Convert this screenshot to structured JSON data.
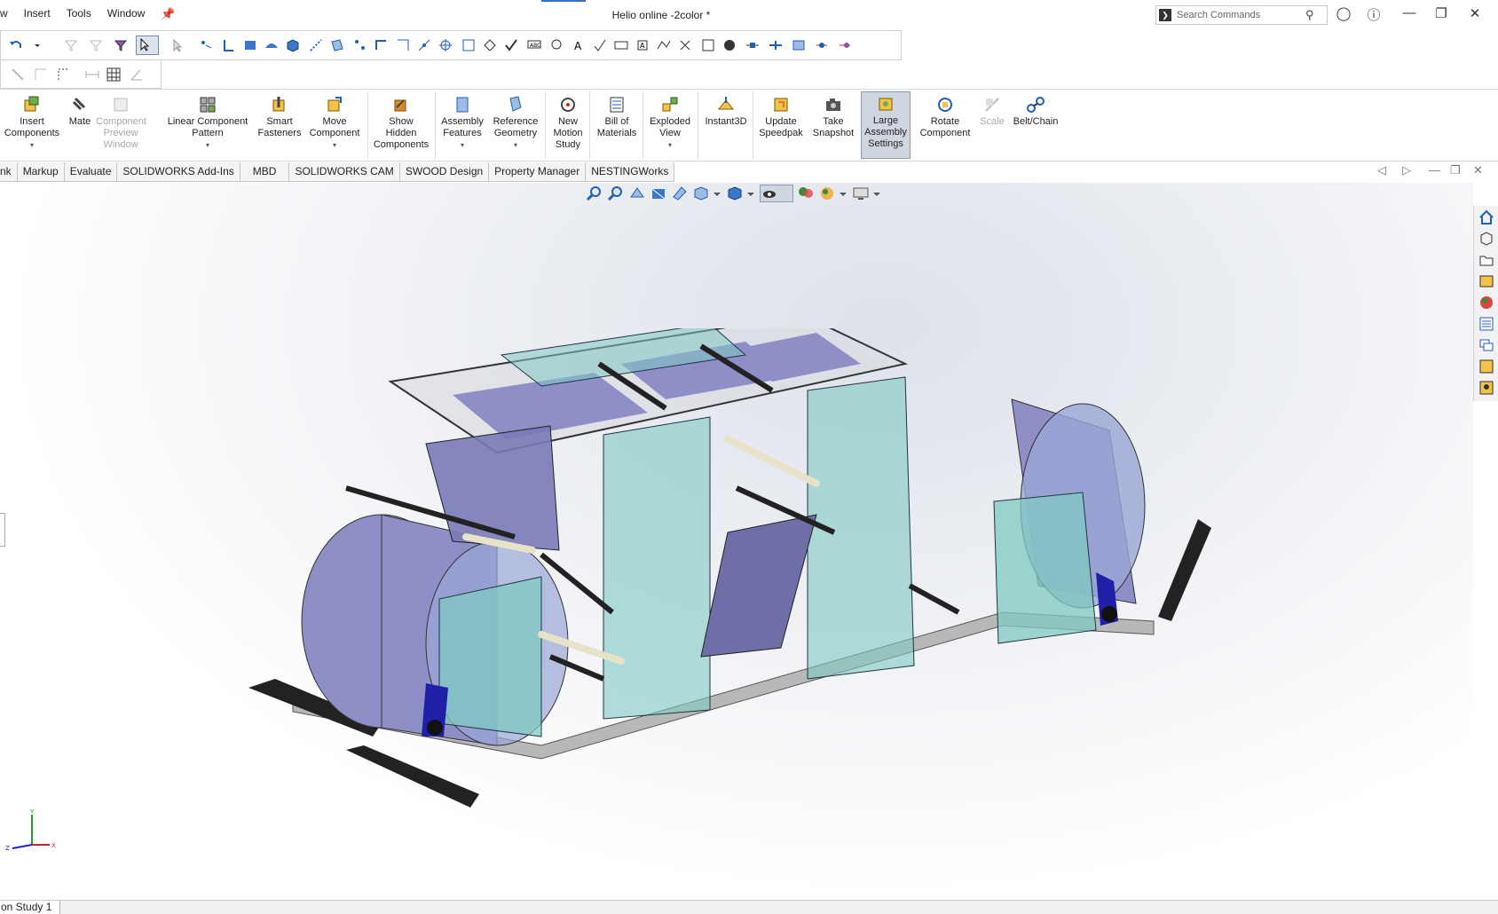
{
  "menu": {
    "items": [
      "w",
      "Insert",
      "Tools",
      "Window"
    ]
  },
  "window": {
    "title": "Helio online -2color *"
  },
  "search": {
    "placeholder": "Search Commands"
  },
  "commands": [
    {
      "line1": "Insert",
      "line2": "Components",
      "line3": "",
      "icon": "insert-components-icon"
    },
    {
      "line1": "Mate",
      "line2": "",
      "line3": "",
      "icon": "mate-icon"
    },
    {
      "line1": "Component",
      "line2": "Preview",
      "line3": "Window",
      "icon": "component-preview-icon"
    },
    {
      "line1": "Linear Component",
      "line2": "Pattern",
      "line3": "",
      "icon": "linear-pattern-icon"
    },
    {
      "line1": "Smart",
      "line2": "Fasteners",
      "line3": "",
      "icon": "smart-fasteners-icon"
    },
    {
      "line1": "Move",
      "line2": "Component",
      "line3": "",
      "icon": "move-component-icon"
    },
    {
      "line1": "Show",
      "line2": "Hidden",
      "line3": "Components",
      "icon": "show-hidden-icon"
    },
    {
      "line1": "Assembly",
      "line2": "Features",
      "line3": "",
      "icon": "assembly-features-icon"
    },
    {
      "line1": "Reference",
      "line2": "Geometry",
      "line3": "",
      "icon": "reference-geometry-icon"
    },
    {
      "line1": "New",
      "line2": "Motion",
      "line3": "Study",
      "icon": "motion-study-icon"
    },
    {
      "line1": "Bill of",
      "line2": "Materials",
      "line3": "",
      "icon": "bom-icon"
    },
    {
      "line1": "Exploded",
      "line2": "View",
      "line3": "",
      "icon": "exploded-view-icon"
    },
    {
      "line1": "Instant3D",
      "line2": "",
      "line3": "",
      "icon": "instant3d-icon"
    },
    {
      "line1": "Update",
      "line2": "Speedpak",
      "line3": "",
      "icon": "speedpak-icon"
    },
    {
      "line1": "Take",
      "line2": "Snapshot",
      "line3": "",
      "icon": "camera-icon"
    },
    {
      "line1": "Large",
      "line2": "Assembly",
      "line3": "Settings",
      "icon": "large-assembly-icon"
    },
    {
      "line1": "Rotate",
      "line2": "Component",
      "line3": "",
      "icon": "rotate-component-icon"
    },
    {
      "line1": "Scale",
      "line2": "",
      "line3": "",
      "icon": "scale-icon"
    },
    {
      "line1": "Belt/Chain",
      "line2": "",
      "line3": "",
      "icon": "belt-chain-icon"
    }
  ],
  "tabs": [
    "nk",
    "Markup",
    "Evaluate",
    "SOLIDWORKS Add-Ins",
    "MBD",
    "SOLIDWORKS CAM",
    "SWOOD Design",
    "Property Manager",
    "NESTINGWorks"
  ],
  "bottom": {
    "tab": "on Study 1"
  },
  "triad": {
    "x": "X",
    "y": "Y",
    "z": "Z"
  },
  "colors": {
    "accent": "#2f6fd0",
    "glass": "#7fc9c2",
    "film": "#8f8fc8",
    "frame": "#b8b8b8"
  }
}
